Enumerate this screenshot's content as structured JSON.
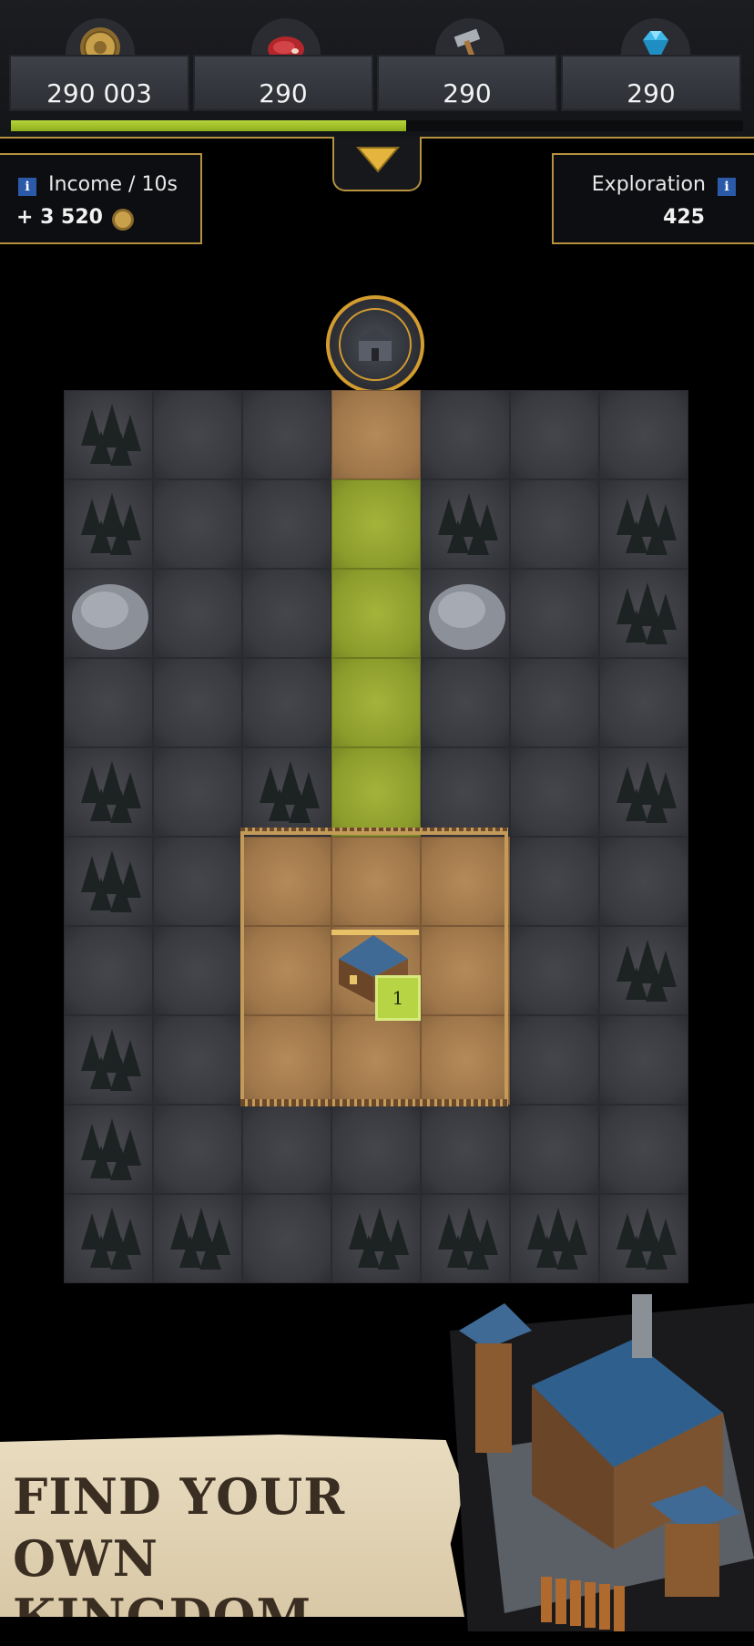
{
  "resources": [
    {
      "name": "gold",
      "value": "290 003",
      "icon": "gold-coin-icon"
    },
    {
      "name": "food",
      "value": "290",
      "icon": "meat-icon"
    },
    {
      "name": "tools",
      "value": "290",
      "icon": "hammer-icon"
    },
    {
      "name": "gems",
      "value": "290",
      "icon": "diamond-icon"
    }
  ],
  "progress": 0.54,
  "income": {
    "info": "i",
    "label": "Income / 10s",
    "value": "+ 3 520"
  },
  "exploration": {
    "info": "i",
    "label": "Exploration",
    "value": "425"
  },
  "house_level": "1",
  "banner": {
    "line1": "FIND YOUR",
    "line2": "OWN KINGDOM"
  },
  "colors": {
    "accent": "#b5923e",
    "grass": "#96a630",
    "dirt": "#a57c4d",
    "tile": "#3b3c42"
  },
  "map_tiles": [
    "forest",
    "plain",
    "plain",
    "dirt",
    "plain",
    "plain",
    "plain",
    "forest",
    "plain",
    "plain",
    "grass",
    "forest",
    "plain",
    "forest",
    "rock",
    "plain",
    "plain",
    "grass",
    "rock",
    "plain",
    "forest",
    "plain",
    "plain",
    "plain",
    "grass",
    "plain",
    "plain",
    "plain",
    "forest",
    "plain",
    "forest",
    "grass",
    "plain",
    "plain",
    "forest",
    "forest",
    "plain",
    "dirt",
    "dirt",
    "dirt",
    "plain",
    "plain",
    "plain",
    "plain",
    "dirt",
    "dirt",
    "dirt",
    "plain",
    "forest",
    "forest",
    "plain",
    "dirt",
    "dirt",
    "dirt",
    "plain",
    "plain",
    "forest",
    "plain",
    "plain",
    "plain",
    "plain",
    "plain",
    "plain",
    "forest",
    "forest",
    "plain",
    "forest",
    "forest",
    "forest",
    "forest"
  ]
}
